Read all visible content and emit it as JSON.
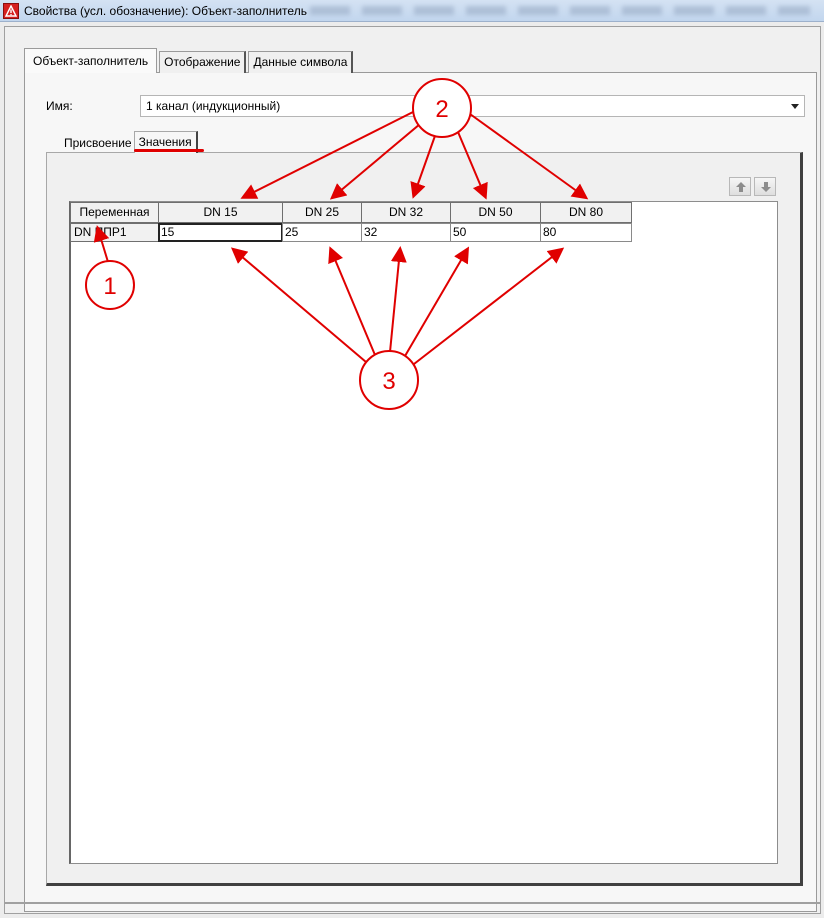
{
  "window": {
    "title": "Свойства (усл. обозначение): Объект-заполнитель"
  },
  "tabs": [
    {
      "label": "Объект-заполнитель",
      "active": true
    },
    {
      "label": "Отображение",
      "active": false
    },
    {
      "label": "Данные символа",
      "active": false
    }
  ],
  "name": {
    "label": "Имя:",
    "value": "1 канал (индукционный)"
  },
  "subtabs": [
    {
      "label": "Присвоение",
      "active": false
    },
    {
      "label": "Значения",
      "active": true
    }
  ],
  "move_buttons": {
    "up_icon": "arrow-up-icon",
    "down_icon": "arrow-down-icon"
  },
  "table": {
    "corner_header": "Переменная",
    "columns": [
      "DN 15",
      "DN 25",
      "DN 32",
      "DN 50",
      "DN 80"
    ],
    "rows": [
      {
        "label": "DN ППР1",
        "values": [
          "15",
          "25",
          "32",
          "50",
          "80"
        ]
      }
    ]
  },
  "annotations": {
    "color": "#e00000",
    "markers": [
      "1",
      "2",
      "3"
    ]
  }
}
